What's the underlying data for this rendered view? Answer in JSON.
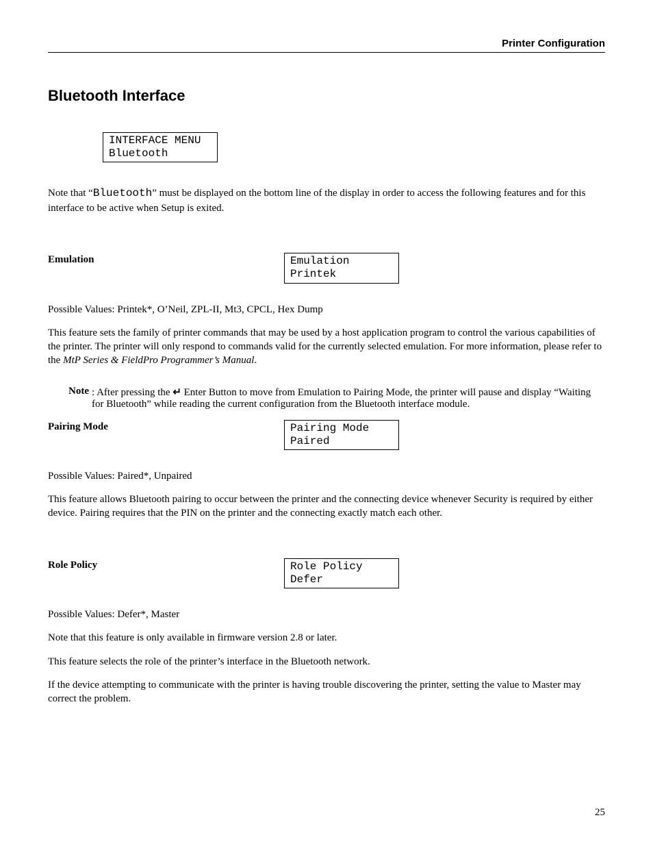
{
  "header": {
    "title": "Printer Configuration"
  },
  "section": {
    "title": "Bluetooth Interface"
  },
  "lcd_main": {
    "line1": "INTERFACE MENU",
    "line2": "Bluetooth"
  },
  "intro": {
    "part1": "Note that “",
    "mono": "Bluetooth",
    "part2": "” must be displayed on the bottom line of the display in order to access the following features and for this interface to be active when Setup is exited."
  },
  "emulation": {
    "label": "Emulation",
    "lcd": {
      "line1": "Emulation",
      "line2": "Printek"
    },
    "possible": "Possible Values:  Printek*, O’Neil, ZPL-II, Mt3, CPCL, Hex Dump",
    "desc_part1": "This feature sets the family of printer commands that may be used by a host application program to control the various capabilities of the printer.  The printer will only respond to commands valid for the currently selected emulation.  For more information, please refer to the ",
    "desc_italic": "MtP Series & FieldPro Programmer’s Manual",
    "desc_part2": "."
  },
  "note": {
    "label": "Note",
    "part1": ": After pressing the ",
    "icon": "↵",
    "part2": " Enter Button to move from Emulation to Pairing Mode, the printer will pause and display “Waiting for Bluetooth” while reading the current configuration from the Bluetooth interface module."
  },
  "pairing": {
    "label": "Pairing Mode",
    "lcd": {
      "line1": "Pairing Mode",
      "line2": "Paired"
    },
    "possible": "Possible Values:  Paired*, Unpaired",
    "desc": "This feature allows Bluetooth pairing to occur between the printer and the connecting device whenever Security is required by either device.  Pairing requires that the PIN on the printer and the connecting exactly match each other."
  },
  "role": {
    "label": "Role Policy",
    "lcd": {
      "line1": "Role Policy",
      "line2": "Defer"
    },
    "possible": "Possible Values:  Defer*, Master",
    "fw": "Note that this feature is only available in firmware version 2.8 or later.",
    "desc": "This feature selects the role of the printer’s interface in the Bluetooth network.",
    "tip": "If the device attempting to communicate with the printer is having trouble discovering the printer, setting the value to Master may correct the problem."
  },
  "page_number": "25"
}
